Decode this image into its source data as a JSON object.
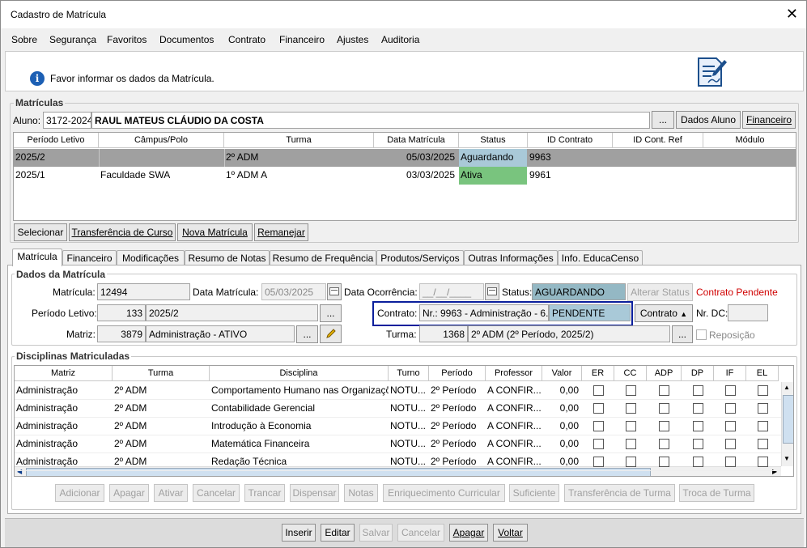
{
  "window": {
    "title": "Cadastro de Matrícula",
    "close": "✕"
  },
  "menu": [
    "Sobre",
    "Segurança",
    "Favoritos",
    "Documentos",
    "Contrato",
    "Financeiro",
    "Ajustes",
    "Auditoria"
  ],
  "info": {
    "icon": "i",
    "text": "Favor informar os dados da Matrícula."
  },
  "matriculas": {
    "label": "Matrículas",
    "aluno_label": "Aluno:",
    "aluno_code": "3172-2024",
    "aluno_name": "RAUL MATEUS CLÁUDIO DA COSTA",
    "ellipsis": "...",
    "dados_aluno": "Dados Aluno",
    "financeiro": "Financeiro",
    "headers": [
      "Período Letivo",
      "Câmpus/Polo",
      "Turma",
      "Data Matrícula",
      "Status",
      "ID Contrato",
      "ID Cont. Ref",
      "Módulo"
    ],
    "rows": [
      {
        "periodo": "2025/2",
        "campus": "",
        "turma": "2º ADM",
        "data": "05/03/2025",
        "status": "Aguardando",
        "id": "9963",
        "ref": "",
        "modulo": ""
      },
      {
        "periodo": "2025/1",
        "campus": "Faculdade SWA",
        "turma": "1º ADM A",
        "data": "03/03/2025",
        "status": "Ativa",
        "id": "9961",
        "ref": "",
        "modulo": ""
      }
    ],
    "buttons": [
      "Selecionar",
      "Transferência de Curso",
      "Nova Matrícula",
      "Remanejar"
    ]
  },
  "tabs": [
    "Matrícula",
    "Financeiro",
    "Modificações",
    "Resumo de Notas",
    "Resumo de Frequência",
    "Produtos/Serviços",
    "Outras Informações",
    "Info. EducaCenso"
  ],
  "dados": {
    "label": "Dados da Matrícula",
    "matricula_label": "Matrícula:",
    "matricula": "12494",
    "data_matricula_label": "Data Matrícula:",
    "data_matricula": "05/03/2025",
    "data_ocorrencia_label": "Data Ocorrência:",
    "data_ocorrencia": "__/__/____",
    "status_label": "Status:",
    "status": "AGUARDANDO",
    "alterar_status": "Alterar Status",
    "contrato_pendente": "Contrato Pendente",
    "periodo_label": "Período Letivo:",
    "periodo_code": "133",
    "periodo": "2025/2",
    "contrato_label": "Contrato:",
    "contrato": "Nr.: 9963 - Administração - 6.",
    "contrato_status": "PENDENTE",
    "contrato_btn": "Contrato",
    "nrdc_label": "Nr. DC:",
    "nrdc": "",
    "matriz_label": "Matriz:",
    "matriz_code": "3879",
    "matriz": "Administração - ATIVO",
    "turma_label": "Turma:",
    "turma_code": "1368",
    "turma": "2º ADM (2º Período, 2025/2)",
    "reposicao": "Reposição"
  },
  "disciplinas": {
    "label": "Disciplinas Matriculadas",
    "headers": [
      "Matriz",
      "Turma",
      "Disciplina",
      "Turno",
      "Período",
      "Professor",
      "Valor",
      "ER",
      "CC",
      "ADP",
      "DP",
      "IF",
      "EL"
    ],
    "rows": [
      {
        "matriz": "Administração",
        "turma": "2º ADM",
        "disciplina": "Comportamento Humano nas Organizações",
        "turno": "NOTU...",
        "periodo": "2º Período",
        "professor": "A CONFIR...",
        "valor": "0,00"
      },
      {
        "matriz": "Administração",
        "turma": "2º ADM",
        "disciplina": "Contabilidade Gerencial",
        "turno": "NOTU...",
        "periodo": "2º Período",
        "professor": "A CONFIR...",
        "valor": "0,00"
      },
      {
        "matriz": "Administração",
        "turma": "2º ADM",
        "disciplina": "Introdução à Economia",
        "turno": "NOTU...",
        "periodo": "2º Período",
        "professor": "A CONFIR...",
        "valor": "0,00"
      },
      {
        "matriz": "Administração",
        "turma": "2º ADM",
        "disciplina": "Matemática Financeira",
        "turno": "NOTU...",
        "periodo": "2º Período",
        "professor": "A CONFIR...",
        "valor": "0,00"
      },
      {
        "matriz": "Administração",
        "turma": "2º ADM",
        "disciplina": "Redação Técnica",
        "turno": "NOTU...",
        "periodo": "2º Período",
        "professor": "A CONFIR...",
        "valor": "0,00"
      }
    ],
    "actions": [
      "Adicionar",
      "Apagar",
      "Ativar",
      "Cancelar",
      "Trancar",
      "Dispensar",
      "Notas",
      "Enriquecimento Curricular",
      "Suficiente",
      "Transferência de Turma",
      "Troca de Turma"
    ]
  },
  "footer": [
    "Inserir",
    "Editar",
    "Salvar",
    "Cancelar",
    "Apagar",
    "Voltar"
  ],
  "colors": {
    "aguardando": "#a9c9d8",
    "ativa": "#79c47e",
    "selected_row": "#a0a0a0",
    "contrato_highlight": "#0b1f9c",
    "status_field": "#94b8c4"
  }
}
